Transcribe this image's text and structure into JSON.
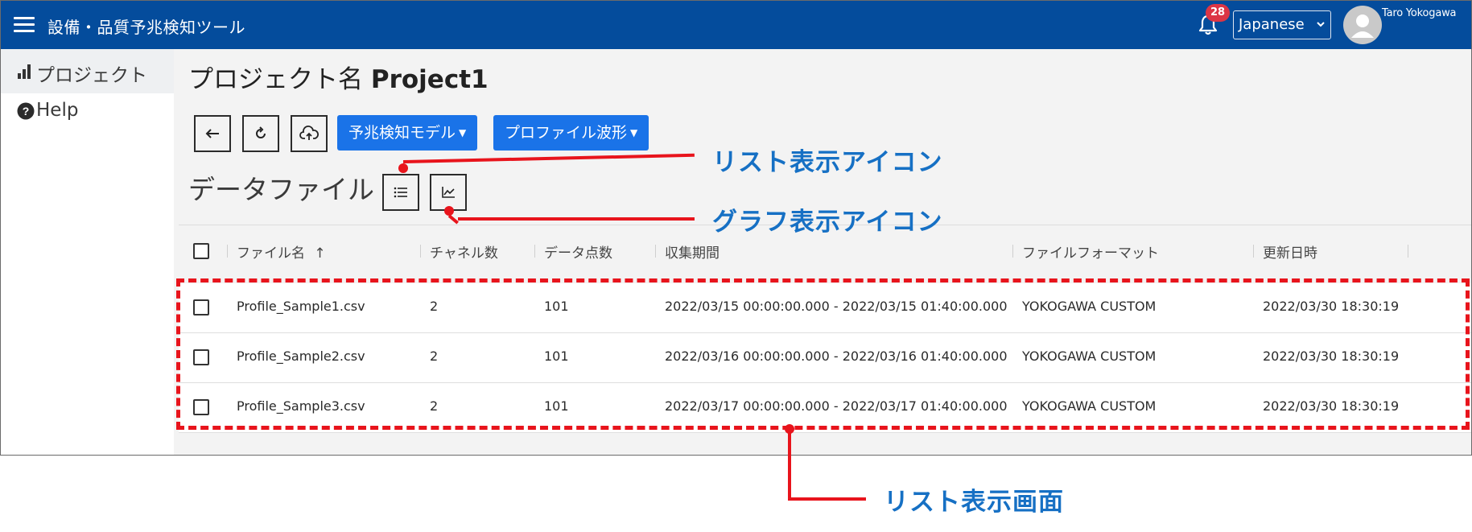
{
  "app": {
    "title": "設備・品質予兆検知ツール",
    "notification_count": "28",
    "language": "Japanese",
    "user_name": "Taro Yokogawa"
  },
  "sidebar": {
    "items": [
      {
        "label": "プロジェクト",
        "icon": "bar-chart-icon"
      },
      {
        "label": "Help",
        "icon": "help-circle-icon"
      }
    ]
  },
  "page": {
    "title_prefix": "プロジェクト名",
    "project_name": "Project1"
  },
  "toolbar": {
    "back_icon": "arrow-left-icon",
    "refresh_icon": "refresh-icon",
    "upload_icon": "cloud-upload-icon",
    "model_menu_label": "予兆検知モデル",
    "profile_menu_label": "プロファイル波形"
  },
  "datafiles": {
    "section_title": "データファイル",
    "columns": [
      "ファイル名",
      "チャネル数",
      "データ点数",
      "収集期間",
      "ファイルフォーマット",
      "更新日時"
    ],
    "sort_indicator": "↑",
    "rows": [
      {
        "file": "Profile_Sample1.csv",
        "channels": "2",
        "points": "101",
        "period": "2022/03/15 00:00:00.000 - 2022/03/15 01:40:00.000",
        "format": "YOKOGAWA CUSTOM",
        "updated": "2022/03/30 18:30:19"
      },
      {
        "file": "Profile_Sample2.csv",
        "channels": "2",
        "points": "101",
        "period": "2022/03/16 00:00:00.000 - 2022/03/16 01:40:00.000",
        "format": "YOKOGAWA CUSTOM",
        "updated": "2022/03/30 18:30:19"
      },
      {
        "file": "Profile_Sample3.csv",
        "channels": "2",
        "points": "101",
        "period": "2022/03/17 00:00:00.000 - 2022/03/17 01:40:00.000",
        "format": "YOKOGAWA CUSTOM",
        "updated": "2022/03/30 18:30:19"
      }
    ]
  },
  "annotations": {
    "list_icon": "リスト表示アイコン",
    "graph_icon": "グラフ表示アイコン",
    "list_view": "リスト表示画面"
  },
  "colors": {
    "header_bg": "#044c9c",
    "button_blue": "#1a73e8",
    "badge_red": "#dc3545",
    "annotation_red": "#e8141c",
    "annotation_text": "#1670c4"
  }
}
